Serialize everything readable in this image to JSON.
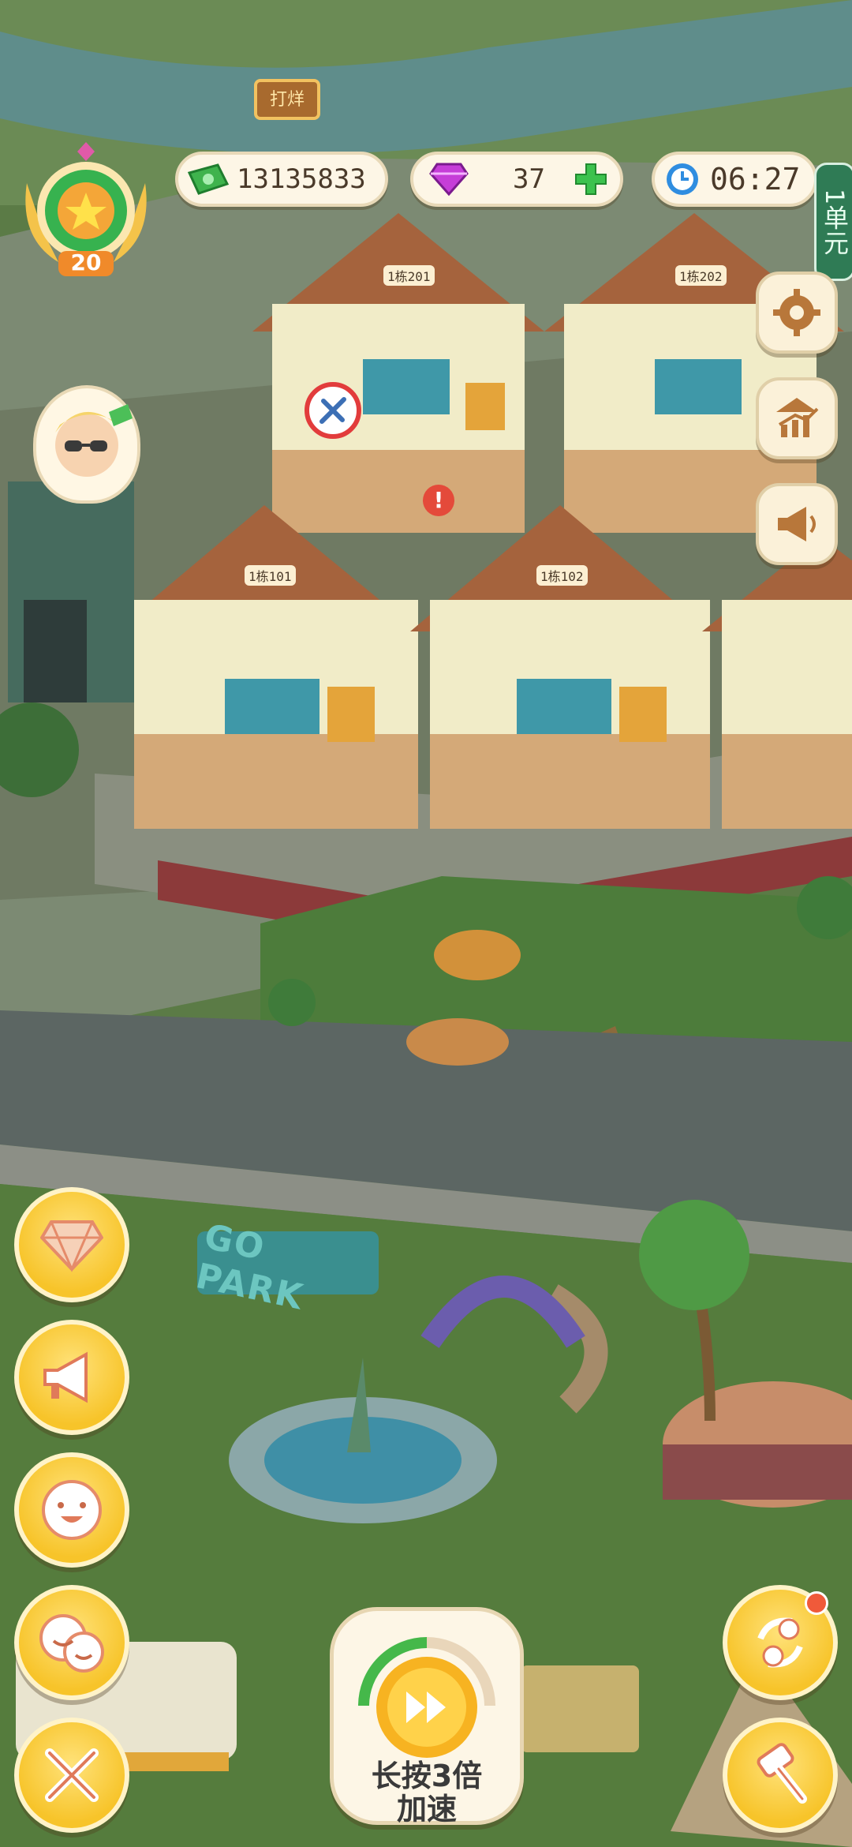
{
  "hud": {
    "level": "20",
    "cash": "13135833",
    "gems": "37",
    "timer": "06:27",
    "unit_tag": "1单元"
  },
  "boost": {
    "label_line1": "长按3倍",
    "label_line2": "加速"
  },
  "rooms": [
    {
      "label": "1栋201"
    },
    {
      "label": "1栋202"
    },
    {
      "label": "1栋101"
    },
    {
      "label": "1栋102"
    }
  ],
  "sign": {
    "text": "打烊"
  },
  "park_sign": {
    "text": "GO PARK"
  },
  "icons": {
    "cash": "cash-icon",
    "gem": "gem-icon",
    "clock": "clock-icon",
    "add": "plus-icon",
    "settings": "gear-icon",
    "stats": "chart-up-icon",
    "announce": "megaphone-icon"
  },
  "colors": {
    "accent": "#f7c42a",
    "gem": "#c63ed8",
    "cash": "#3fb34d",
    "clock": "#2f8de0"
  }
}
